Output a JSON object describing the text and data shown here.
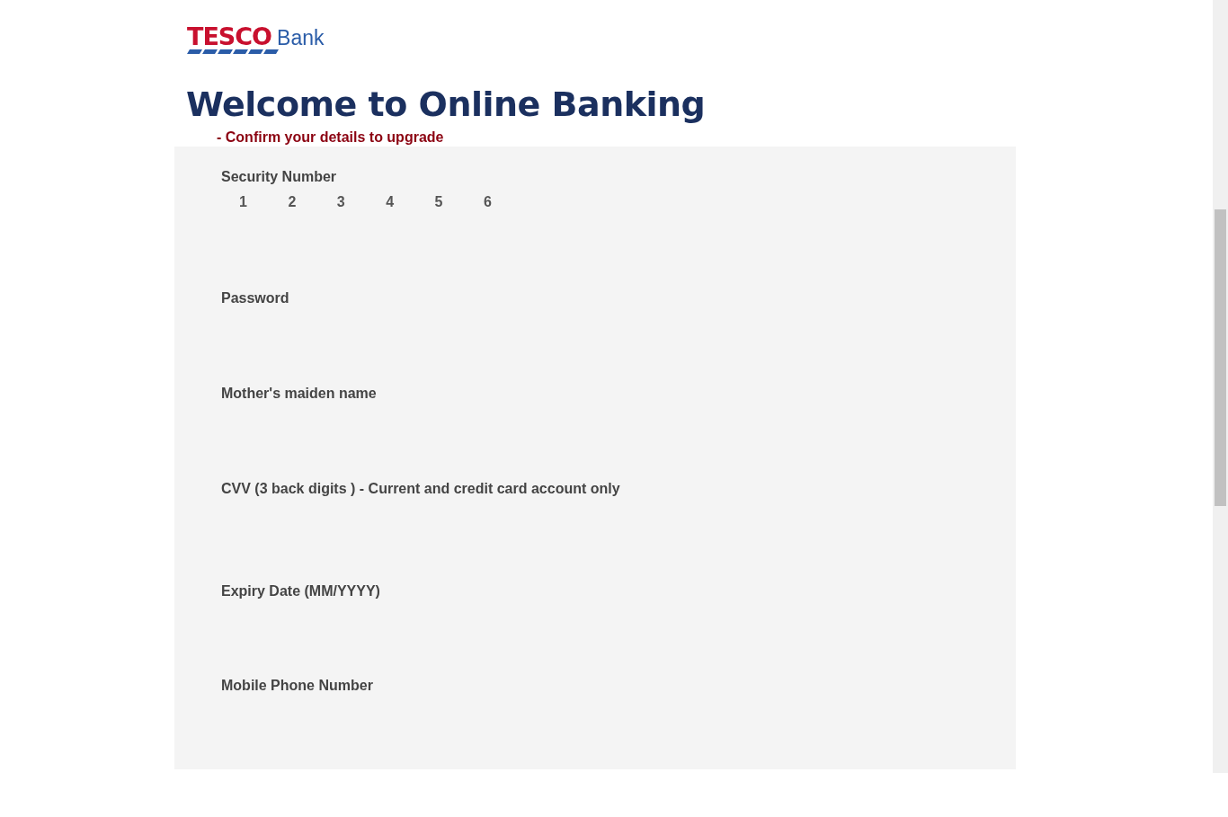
{
  "logo": {
    "brand": "TESCO",
    "product": "Bank"
  },
  "heading": "Welcome to Online Banking",
  "subtitle": "- Confirm your details to upgrade",
  "fields": [
    {
      "kind": "digits",
      "label": "Security Number",
      "digits": [
        "1",
        "2",
        "3",
        "4",
        "5",
        "6"
      ]
    },
    {
      "kind": "text",
      "label": "Password"
    },
    {
      "kind": "text",
      "label": "Mother's maiden name"
    },
    {
      "kind": "text",
      "label": "CVV (3 back digits ) - Current and credit card account only"
    },
    {
      "kind": "text",
      "label": "Expiry Date (MM/YYYY)"
    },
    {
      "kind": "text",
      "label": "Mobile Phone Number"
    }
  ]
}
